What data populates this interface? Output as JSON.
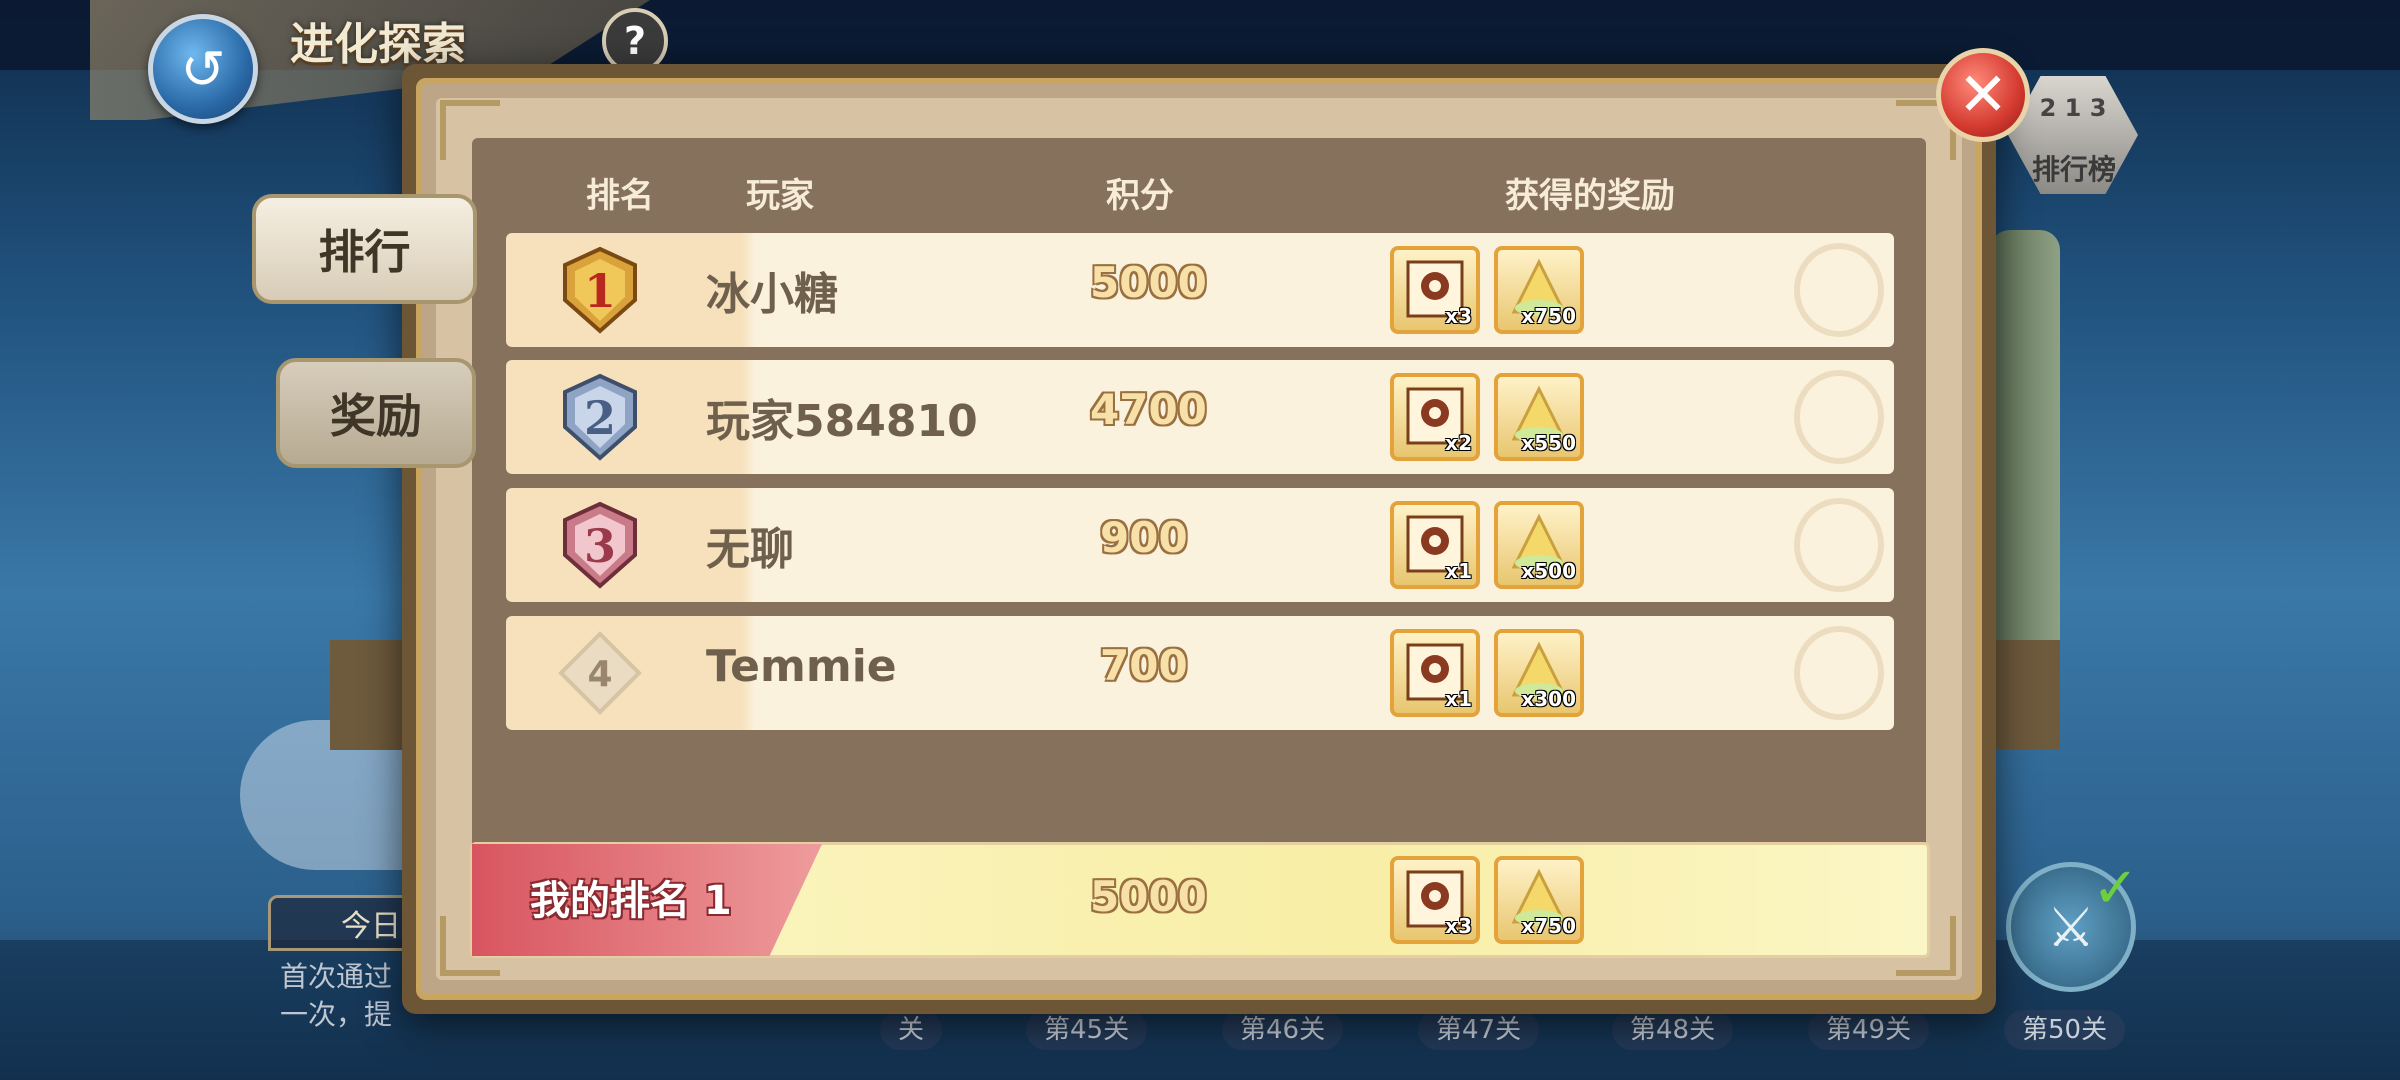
{
  "header": {
    "title": "进化探索",
    "help": "?"
  },
  "tabs": [
    {
      "label": "排行"
    },
    {
      "label": "奖励"
    }
  ],
  "columns": {
    "rank": "排名",
    "player": "玩家",
    "score": "积分",
    "rewards": "获得的奖励"
  },
  "rows": [
    {
      "rank": "1",
      "player": "冰小糖",
      "score": "5000",
      "rewards": [
        {
          "icon": "card-pack-icon",
          "count": "x3"
        },
        {
          "icon": "gold-pile-icon",
          "count": "x750"
        }
      ]
    },
    {
      "rank": "2",
      "player": "玩家584810",
      "score": "4700",
      "rewards": [
        {
          "icon": "card-pack-icon",
          "count": "x2"
        },
        {
          "icon": "gold-pile-icon",
          "count": "x550"
        }
      ]
    },
    {
      "rank": "3",
      "player": "无聊",
      "score": "900",
      "rewards": [
        {
          "icon": "card-pack-icon",
          "count": "x1"
        },
        {
          "icon": "gold-pile-icon",
          "count": "x500"
        }
      ]
    },
    {
      "rank": "4",
      "player": "Temmie",
      "score": "700",
      "rewards": [
        {
          "icon": "card-pack-icon",
          "count": "x1"
        },
        {
          "icon": "gold-pile-icon",
          "count": "x300"
        }
      ]
    }
  ],
  "my_rank": {
    "label": "我的排名 1",
    "score": "5000",
    "rewards": [
      {
        "icon": "card-pack-icon",
        "count": "x3"
      },
      {
        "icon": "gold-pile-icon",
        "count": "x750"
      }
    ]
  },
  "leaderboard_button": {
    "label": "排行榜",
    "podium": "2 1 3"
  },
  "background": {
    "today_tab": "今日",
    "description": "首次通过\n一次，提",
    "stages": [
      "关",
      "第45关",
      "第46关",
      "第47关",
      "第48关",
      "第49关",
      "第50关"
    ]
  },
  "colors": {
    "gold_medal": "#d9a23a",
    "silver_medal": "#8fa4c4",
    "bronze_medal": "#c97b8a",
    "my_rank_red": "#d85560",
    "score_outline": "#9a7040"
  }
}
